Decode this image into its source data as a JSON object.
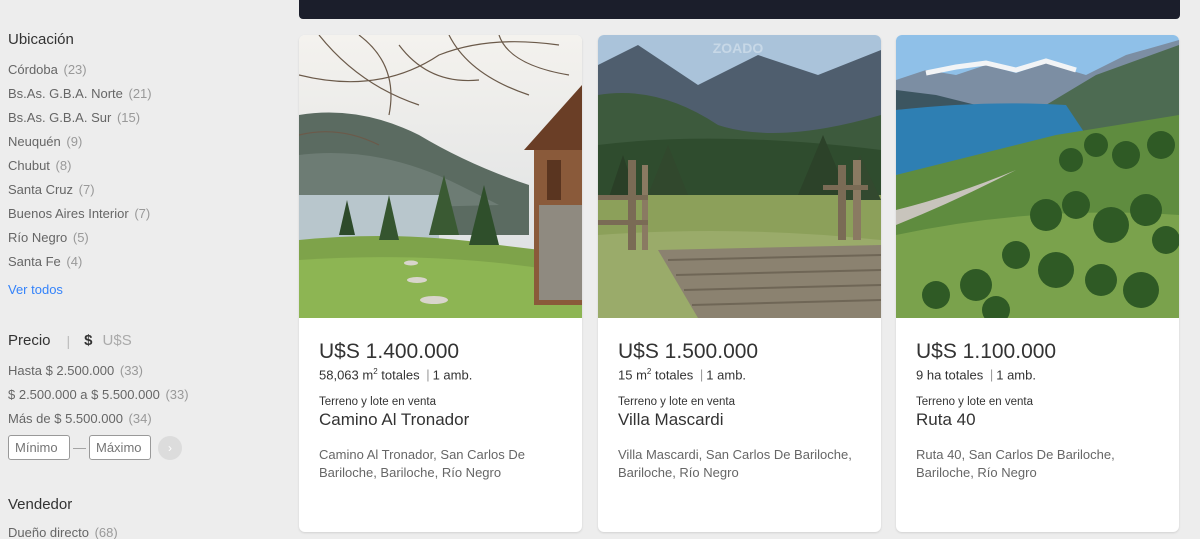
{
  "location": {
    "title": "Ubicación",
    "items": [
      {
        "label": "Córdoba",
        "count": "(23)"
      },
      {
        "label": "Bs.As. G.B.A. Norte",
        "count": "(21)"
      },
      {
        "label": "Bs.As. G.B.A. Sur",
        "count": "(15)"
      },
      {
        "label": "Neuquén",
        "count": "(9)"
      },
      {
        "label": "Chubut",
        "count": "(8)"
      },
      {
        "label": "Santa Cruz",
        "count": "(7)"
      },
      {
        "label": "Buenos Aires Interior",
        "count": "(7)"
      },
      {
        "label": "Río Negro",
        "count": "(5)"
      },
      {
        "label": "Santa Fe",
        "count": "(4)"
      }
    ],
    "see_all": "Ver todos"
  },
  "price": {
    "title": "Precio",
    "separator": "|",
    "currency_active": "$",
    "currency_inactive": "U$S",
    "ranges": [
      {
        "label": "Hasta $ 2.500.000",
        "count": "(33)"
      },
      {
        "label": "$ 2.500.000 a $ 5.500.000",
        "count": "(33)"
      },
      {
        "label": "Más de $ 5.500.000",
        "count": "(34)"
      }
    ],
    "min_placeholder": "Mínimo",
    "max_placeholder": "Máximo",
    "dash": "—"
  },
  "vendor": {
    "title": "Vendedor",
    "items": [
      {
        "label": "Dueño directo",
        "count": "(68)"
      }
    ]
  },
  "listings": [
    {
      "price": "U$S 1.400.000",
      "area_value": "58,063 m",
      "area_sup": "2",
      "area_unit": " totales",
      "divider": "|",
      "rooms": "1 amb.",
      "type": "Terreno y lote en venta",
      "name": "Camino Al Tronador",
      "address": "Camino Al Tronador, San Carlos De Bariloche, Bariloche, Río Negro"
    },
    {
      "price": "U$S 1.500.000",
      "area_value": "15 m",
      "area_sup": "2",
      "area_unit": " totales",
      "divider": "|",
      "rooms": "1 amb.",
      "type": "Terreno y lote en venta",
      "name": "Villa Mascardi",
      "address": "Villa Mascardi, San Carlos De Bariloche, Bariloche, Río Negro"
    },
    {
      "price": "U$S 1.100.000",
      "area_value": "9 ha totales",
      "area_sup": "",
      "area_unit": "",
      "divider": "|",
      "rooms": "1 amb.",
      "type": "Terreno y lote en venta",
      "name": "Ruta 40",
      "address": "Ruta 40, San Carlos De Bariloche, Bariloche, Río Negro"
    }
  ],
  "colors": {
    "link": "#3483fa",
    "topbar": "#1b1e2b",
    "background": "#ededed"
  }
}
